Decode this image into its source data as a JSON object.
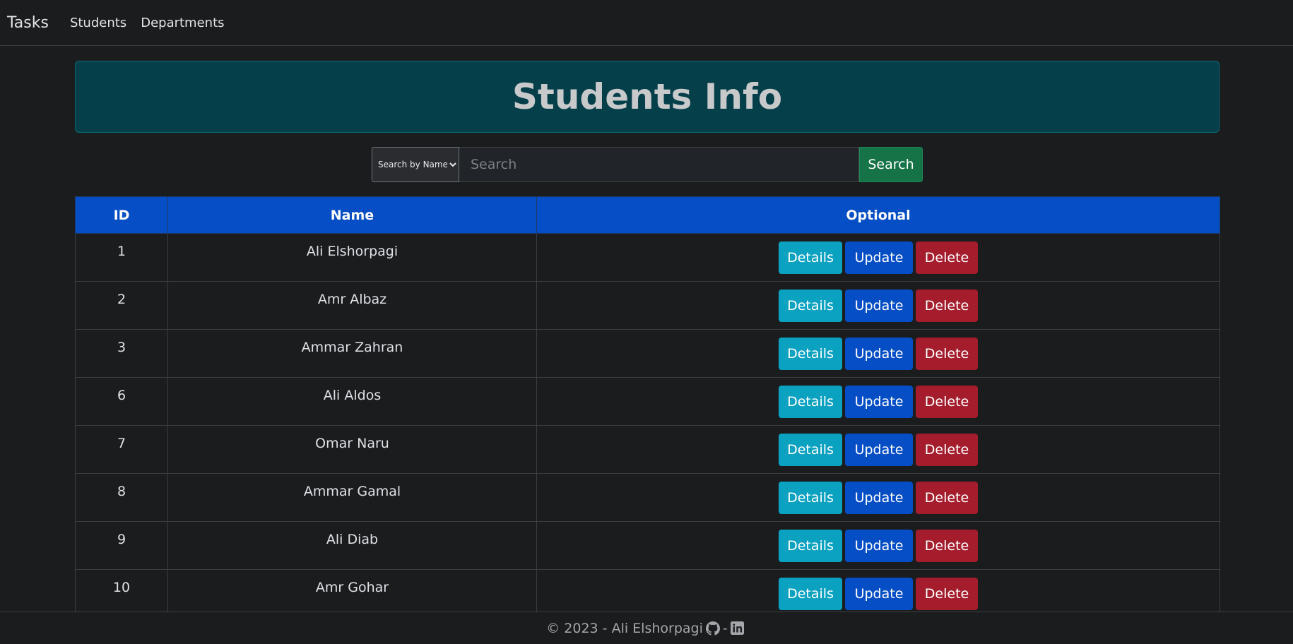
{
  "navbar": {
    "brand": "Tasks",
    "links": [
      "Students",
      "Departments"
    ]
  },
  "banner": {
    "title": "Students Info"
  },
  "search": {
    "select_value": "Search by Name",
    "placeholder": "Search",
    "button_label": "Search"
  },
  "table": {
    "headers": [
      "ID",
      "Name",
      "Optional"
    ],
    "rows": [
      {
        "id": "1",
        "name": "Ali Elshorpagi"
      },
      {
        "id": "2",
        "name": "Amr Albaz"
      },
      {
        "id": "3",
        "name": "Ammar Zahran"
      },
      {
        "id": "6",
        "name": "Ali Aldos"
      },
      {
        "id": "7",
        "name": "Omar Naru"
      },
      {
        "id": "8",
        "name": "Ammar Gamal"
      },
      {
        "id": "9",
        "name": "Ali Diab"
      },
      {
        "id": "10",
        "name": "Amr Gohar"
      }
    ],
    "actions": {
      "details": "Details",
      "update": "Update",
      "delete": "Delete"
    }
  },
  "footer": {
    "text": "© 2023 - Ali Elshorpagi",
    "separator": "-",
    "icons": [
      "github-icon",
      "linkedin-icon"
    ]
  },
  "colors": {
    "background": "#1b1c1e",
    "banner": "#053f4a",
    "header": "#054ec5",
    "details": "#0aa2c0",
    "update": "#054ec5",
    "delete": "#a51d2d",
    "search_button": "#157347"
  }
}
